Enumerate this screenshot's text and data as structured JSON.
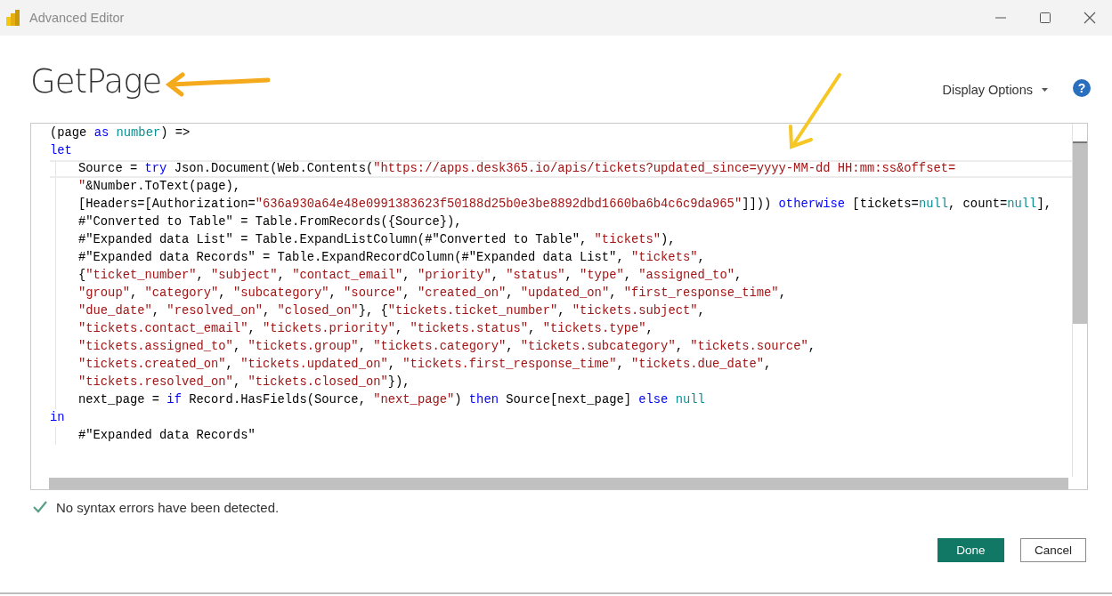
{
  "window": {
    "title": "Advanced Editor"
  },
  "query_name": "GetPage",
  "display_options": {
    "label": "Display Options"
  },
  "help": {
    "label": "?"
  },
  "code_lines": [
    {
      "indented": false,
      "current": false,
      "tokens": [
        {
          "kind": "plain",
          "text": "(page "
        },
        {
          "kind": "keyword",
          "text": "as "
        },
        {
          "kind": "type",
          "text": "number"
        },
        {
          "kind": "plain",
          "text": ") =>"
        }
      ]
    },
    {
      "indented": false,
      "current": false,
      "tokens": [
        {
          "kind": "keyword",
          "text": "let"
        }
      ]
    },
    {
      "indented": true,
      "current": true,
      "tokens": [
        {
          "kind": "plain",
          "text": "Source = "
        },
        {
          "kind": "keyword",
          "text": "try"
        },
        {
          "kind": "plain",
          "text": " Json.Document(Web.Contents("
        },
        {
          "kind": "string",
          "text": "\"https://apps.desk365.io/apis/tickets?updated_since=yyyy-MM-dd HH:mm:ss&offset="
        }
      ]
    },
    {
      "indented": true,
      "current": false,
      "tokens": [
        {
          "kind": "string",
          "text": "\""
        },
        {
          "kind": "plain",
          "text": "&Number.ToText(page),"
        }
      ]
    },
    {
      "indented": true,
      "current": false,
      "tokens": [
        {
          "kind": "plain",
          "text": "[Headers=[Authorization="
        },
        {
          "kind": "string",
          "text": "\"636a930a64e48e0991383623f50188d25b0e3be8892dbd1660ba6b4c6c9da965\""
        },
        {
          "kind": "plain",
          "text": "]])) "
        },
        {
          "kind": "keyword",
          "text": "otherwise"
        },
        {
          "kind": "plain",
          "text": " [tickets="
        },
        {
          "kind": "type",
          "text": "null"
        },
        {
          "kind": "plain",
          "text": ", count="
        },
        {
          "kind": "type",
          "text": "null"
        },
        {
          "kind": "plain",
          "text": "],"
        }
      ]
    },
    {
      "indented": true,
      "current": false,
      "tokens": [
        {
          "kind": "plain",
          "text": "#\"Converted to Table\" = Table.FromRecords({Source}),"
        }
      ]
    },
    {
      "indented": true,
      "current": false,
      "tokens": [
        {
          "kind": "plain",
          "text": "#\"Expanded data List\" = Table.ExpandListColumn(#\"Converted to Table\", "
        },
        {
          "kind": "string",
          "text": "\"tickets\""
        },
        {
          "kind": "plain",
          "text": "),"
        }
      ]
    },
    {
      "indented": true,
      "current": false,
      "tokens": [
        {
          "kind": "plain",
          "text": "#\"Expanded data Records\" = Table.ExpandRecordColumn(#\"Expanded data List\", "
        },
        {
          "kind": "string",
          "text": "\"tickets\""
        },
        {
          "kind": "plain",
          "text": ","
        }
      ]
    },
    {
      "indented": true,
      "current": false,
      "tokens": [
        {
          "kind": "plain",
          "text": "{"
        },
        {
          "kind": "string",
          "text": "\"ticket_number\""
        },
        {
          "kind": "plain",
          "text": ", "
        },
        {
          "kind": "string",
          "text": "\"subject\""
        },
        {
          "kind": "plain",
          "text": ", "
        },
        {
          "kind": "string",
          "text": "\"contact_email\""
        },
        {
          "kind": "plain",
          "text": ", "
        },
        {
          "kind": "string",
          "text": "\"priority\""
        },
        {
          "kind": "plain",
          "text": ", "
        },
        {
          "kind": "string",
          "text": "\"status\""
        },
        {
          "kind": "plain",
          "text": ", "
        },
        {
          "kind": "string",
          "text": "\"type\""
        },
        {
          "kind": "plain",
          "text": ", "
        },
        {
          "kind": "string",
          "text": "\"assigned_to\""
        },
        {
          "kind": "plain",
          "text": ","
        }
      ]
    },
    {
      "indented": true,
      "current": false,
      "tokens": [
        {
          "kind": "string",
          "text": "\"group\""
        },
        {
          "kind": "plain",
          "text": ", "
        },
        {
          "kind": "string",
          "text": "\"category\""
        },
        {
          "kind": "plain",
          "text": ", "
        },
        {
          "kind": "string",
          "text": "\"subcategory\""
        },
        {
          "kind": "plain",
          "text": ", "
        },
        {
          "kind": "string",
          "text": "\"source\""
        },
        {
          "kind": "plain",
          "text": ", "
        },
        {
          "kind": "string",
          "text": "\"created_on\""
        },
        {
          "kind": "plain",
          "text": ", "
        },
        {
          "kind": "string",
          "text": "\"updated_on\""
        },
        {
          "kind": "plain",
          "text": ", "
        },
        {
          "kind": "string",
          "text": "\"first_response_time\""
        },
        {
          "kind": "plain",
          "text": ","
        }
      ]
    },
    {
      "indented": true,
      "current": false,
      "tokens": [
        {
          "kind": "string",
          "text": "\"due_date\""
        },
        {
          "kind": "plain",
          "text": ", "
        },
        {
          "kind": "string",
          "text": "\"resolved_on\""
        },
        {
          "kind": "plain",
          "text": ", "
        },
        {
          "kind": "string",
          "text": "\"closed_on\""
        },
        {
          "kind": "plain",
          "text": "}, {"
        },
        {
          "kind": "string",
          "text": "\"tickets.ticket_number\""
        },
        {
          "kind": "plain",
          "text": ", "
        },
        {
          "kind": "string",
          "text": "\"tickets.subject\""
        },
        {
          "kind": "plain",
          "text": ","
        }
      ]
    },
    {
      "indented": true,
      "current": false,
      "tokens": [
        {
          "kind": "string",
          "text": "\"tickets.contact_email\""
        },
        {
          "kind": "plain",
          "text": ", "
        },
        {
          "kind": "string",
          "text": "\"tickets.priority\""
        },
        {
          "kind": "plain",
          "text": ", "
        },
        {
          "kind": "string",
          "text": "\"tickets.status\""
        },
        {
          "kind": "plain",
          "text": ", "
        },
        {
          "kind": "string",
          "text": "\"tickets.type\""
        },
        {
          "kind": "plain",
          "text": ","
        }
      ]
    },
    {
      "indented": true,
      "current": false,
      "tokens": [
        {
          "kind": "string",
          "text": "\"tickets.assigned_to\""
        },
        {
          "kind": "plain",
          "text": ", "
        },
        {
          "kind": "string",
          "text": "\"tickets.group\""
        },
        {
          "kind": "plain",
          "text": ", "
        },
        {
          "kind": "string",
          "text": "\"tickets.category\""
        },
        {
          "kind": "plain",
          "text": ", "
        },
        {
          "kind": "string",
          "text": "\"tickets.subcategory\""
        },
        {
          "kind": "plain",
          "text": ", "
        },
        {
          "kind": "string",
          "text": "\"tickets.source\""
        },
        {
          "kind": "plain",
          "text": ","
        }
      ]
    },
    {
      "indented": true,
      "current": false,
      "tokens": [
        {
          "kind": "string",
          "text": "\"tickets.created_on\""
        },
        {
          "kind": "plain",
          "text": ", "
        },
        {
          "kind": "string",
          "text": "\"tickets.updated_on\""
        },
        {
          "kind": "plain",
          "text": ", "
        },
        {
          "kind": "string",
          "text": "\"tickets.first_response_time\""
        },
        {
          "kind": "plain",
          "text": ", "
        },
        {
          "kind": "string",
          "text": "\"tickets.due_date\""
        },
        {
          "kind": "plain",
          "text": ","
        }
      ]
    },
    {
      "indented": true,
      "current": false,
      "tokens": [
        {
          "kind": "string",
          "text": "\"tickets.resolved_on\""
        },
        {
          "kind": "plain",
          "text": ", "
        },
        {
          "kind": "string",
          "text": "\"tickets.closed_on\""
        },
        {
          "kind": "plain",
          "text": "}),"
        }
      ]
    },
    {
      "indented": true,
      "current": false,
      "tokens": [
        {
          "kind": "plain",
          "text": "next_page = "
        },
        {
          "kind": "keyword",
          "text": "if"
        },
        {
          "kind": "plain",
          "text": " Record.HasFields(Source, "
        },
        {
          "kind": "string",
          "text": "\"next_page\""
        },
        {
          "kind": "plain",
          "text": ") "
        },
        {
          "kind": "keyword",
          "text": "then"
        },
        {
          "kind": "plain",
          "text": " Source[next_page] "
        },
        {
          "kind": "keyword",
          "text": "else "
        },
        {
          "kind": "type",
          "text": "null"
        }
      ]
    },
    {
      "indented": false,
      "current": false,
      "tokens": [
        {
          "kind": "keyword",
          "text": "in"
        }
      ]
    },
    {
      "indented": true,
      "current": false,
      "tokens": [
        {
          "kind": "plain",
          "text": "#\"Expanded data Records\""
        }
      ]
    }
  ],
  "status": {
    "ok": true,
    "message": "No syntax errors have been detected."
  },
  "buttons": [
    {
      "kind": "primary",
      "label": "Done"
    },
    {
      "kind": "secondary",
      "label": "Cancel"
    }
  ]
}
